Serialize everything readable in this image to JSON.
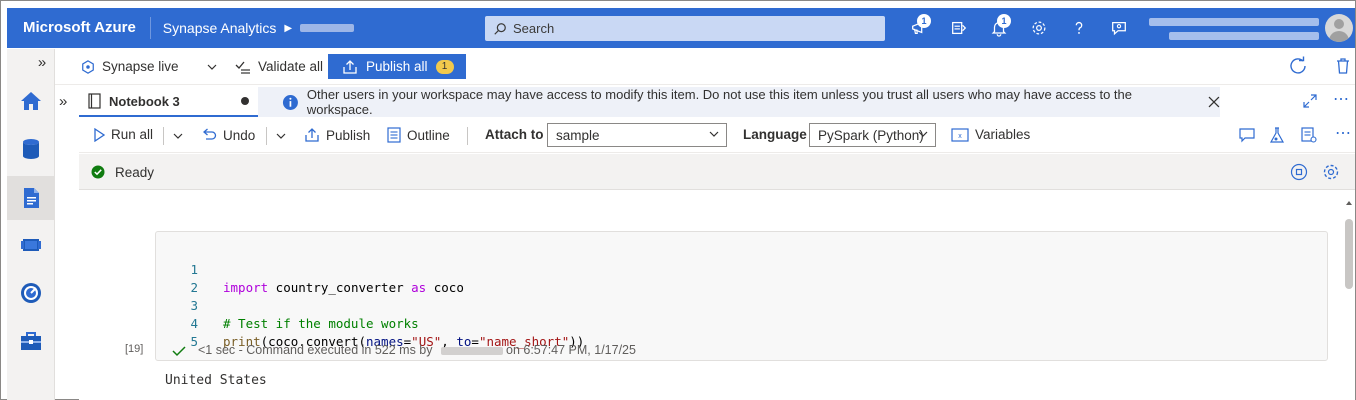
{
  "topbar": {
    "brand": "Microsoft Azure",
    "service": "Synapse Analytics",
    "search_placeholder": "Search",
    "notifications_badge": "1",
    "announcements_badge": "1"
  },
  "secondbar": {
    "mode": "Synapse live",
    "validate_label": "Validate all",
    "publish_all_label": "Publish all",
    "publish_count": "1"
  },
  "tab": {
    "title": "Notebook 3"
  },
  "info_bar": {
    "message": "Other users in your workspace may have access to modify this item. Do not use this item unless you trust all users who may have access to the workspace."
  },
  "toolbar": {
    "run_all": "Run all",
    "undo": "Undo",
    "publish": "Publish",
    "outline": "Outline",
    "attach_label": "Attach to",
    "attach_value": "sample",
    "language_label": "Language",
    "language_value": "PySpark (Python)",
    "variables": "Variables"
  },
  "status": {
    "text": "Ready"
  },
  "cell": {
    "exec_count": "[19]",
    "exec_prefix": "<1 sec - Command executed in 522 ms by",
    "exec_suffix": "on 6:57:47 PM, 1/17/25",
    "lines": [
      "1",
      "2",
      "3",
      "4",
      "5"
    ],
    "code": {
      "l1_kw": "import",
      "l1_mod": " country_converter ",
      "l1_as": "as",
      "l1_alias": " coco",
      "l3": "# Test if the module works",
      "l4_fn": "print",
      "l4_a": "(coco.convert(",
      "l4_p1": "names",
      "l4_eq1": "=",
      "l4_s1": "\"US\"",
      "l4_comma": ", ",
      "l4_p2": "to",
      "l4_eq2": "=",
      "l4_s2": "\"name_short\"",
      "l4_end": "))"
    },
    "output": "United States"
  },
  "colors": {
    "azure_blue": "#2f6bd1",
    "ready_green": "#107c10"
  }
}
